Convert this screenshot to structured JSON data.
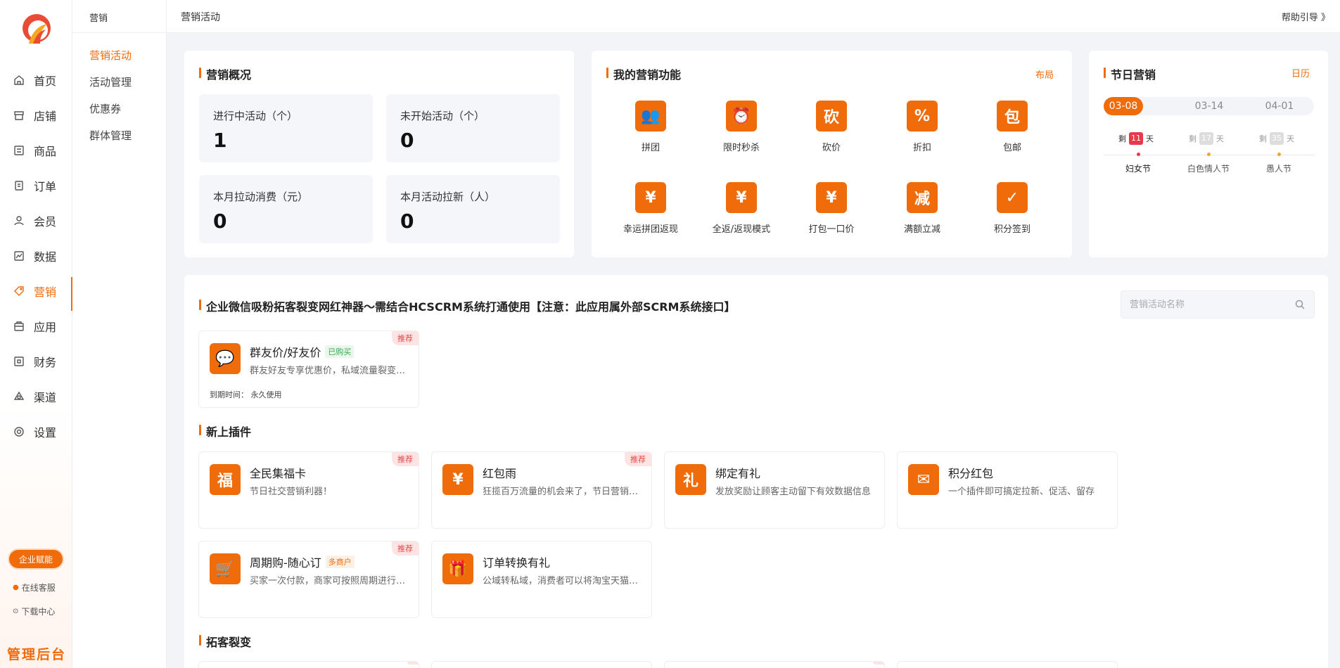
{
  "nav": {
    "items": [
      {
        "label": "首页",
        "icon": "home-icon"
      },
      {
        "label": "店铺",
        "icon": "store-icon"
      },
      {
        "label": "商品",
        "icon": "goods-icon"
      },
      {
        "label": "订单",
        "icon": "order-icon"
      },
      {
        "label": "会员",
        "icon": "member-icon"
      },
      {
        "label": "数据",
        "icon": "chart-icon"
      },
      {
        "label": "营销",
        "icon": "tag-icon"
      },
      {
        "label": "应用",
        "icon": "app-icon"
      },
      {
        "label": "财务",
        "icon": "finance-icon"
      },
      {
        "label": "渠道",
        "icon": "channel-icon"
      },
      {
        "label": "设置",
        "icon": "gear-icon"
      }
    ],
    "badge": "企业赋能",
    "service": "在线客服",
    "download": "下载中心",
    "brand": "管理后台"
  },
  "subnav": {
    "title": "营销",
    "items": [
      "营销活动",
      "活动管理",
      "优惠券",
      "群体管理"
    ]
  },
  "topbar": {
    "breadcrumb": "营销活动",
    "help": "帮助引导 》"
  },
  "overview": {
    "title": "营销概况",
    "stats": [
      {
        "label": "进行中活动（个）",
        "value": "1"
      },
      {
        "label": "未开始活动（个）",
        "value": "0"
      },
      {
        "label": "本月拉动消费（元）",
        "value": "0"
      },
      {
        "label": "本月活动拉新（人）",
        "value": "0"
      }
    ]
  },
  "features": {
    "title": "我的营销功能",
    "layout_link": "布局",
    "items": [
      {
        "label": "拼团",
        "glyph": "👥"
      },
      {
        "label": "限时秒杀",
        "glyph": "⏰"
      },
      {
        "label": "砍价",
        "glyph": "砍"
      },
      {
        "label": "折扣",
        "glyph": "%"
      },
      {
        "label": "包邮",
        "glyph": "包"
      },
      {
        "label": "幸运拼团返现",
        "glyph": "¥"
      },
      {
        "label": "全返/返现模式",
        "glyph": "¥"
      },
      {
        "label": "打包一口价",
        "glyph": "¥"
      },
      {
        "label": "满额立减",
        "glyph": "减"
      },
      {
        "label": "积分签到",
        "glyph": "✓"
      }
    ]
  },
  "holiday": {
    "title": "节日营销",
    "calendar_link": "日历",
    "dates": [
      "03-08",
      "03-14",
      "04-01"
    ],
    "prefix": "剩",
    "suffix": "天",
    "days": [
      "11",
      "17",
      "35"
    ],
    "names": [
      "妇女节",
      "白色情人节",
      "愚人节"
    ]
  },
  "wecom": {
    "title": "企业微信吸粉拓客裂变网红神器～需结合HCSCRM系统打通使用【注意：此应用属外部SCRM系统接口】",
    "search_placeholder": "营销活动名称",
    "plugin": {
      "title": "群友价/好友价",
      "tag": "已购买",
      "desc": "群友好友专享优惠价，私域流量裂变神器",
      "expire_label": "到期时间：",
      "expire_value": "永久使用",
      "badge": "推荐"
    }
  },
  "new_plugins": {
    "title": "新上插件",
    "items": [
      {
        "title": "全民集福卡",
        "desc": "节日社交营销利器！",
        "badge": "推荐",
        "tag": "",
        "glyph": "福"
      },
      {
        "title": "红包雨",
        "desc": "狂揽百万流量的机会来了，节日营销必备",
        "badge": "推荐",
        "tag": "",
        "glyph": "¥"
      },
      {
        "title": "绑定有礼",
        "desc": "发放奖励让顾客主动留下有效数据信息",
        "badge": "",
        "tag": "",
        "glyph": "礼"
      },
      {
        "title": "积分红包",
        "desc": "一个插件即可搞定拉新、促活、留存",
        "badge": "",
        "tag": "",
        "glyph": "✉"
      },
      {
        "title": "周期购-随心订",
        "desc": "买家一次付款，商家可按照周期进行配送",
        "badge": "推荐",
        "tag": "多商户",
        "glyph": "🛒"
      },
      {
        "title": "订单转换有礼",
        "desc": "公域转私域，消费者可以将淘宝天猫订单转换",
        "badge": "",
        "tag": "",
        "glyph": "🎁"
      }
    ]
  },
  "expand": {
    "title": "拓客裂变"
  }
}
